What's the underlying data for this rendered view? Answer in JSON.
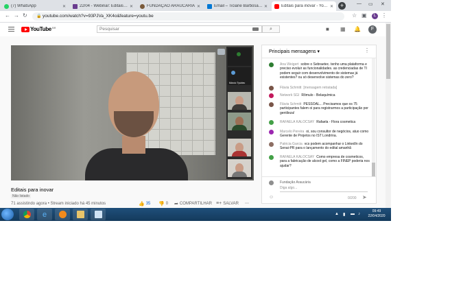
{
  "browser": {
    "tabs": [
      {
        "label": "(7) WhatsApp",
        "color": "#25d366"
      },
      {
        "label": "22/04 - Webinar: Editais para inovar",
        "color": "#6a3c8f"
      },
      {
        "label": "FUNDAÇÃO ARAUCÁRIA",
        "color": "#7a5a3a"
      },
      {
        "label": "Email – Ticiane Barbosa – Outlook",
        "color": "#0078d4"
      },
      {
        "label": "Editais para inovar - YouTube",
        "color": "#ff0000"
      }
    ],
    "url": "youtube.com/watch?v=93PJVa_XK4o&feature=youtu.be",
    "profile_initial": "L"
  },
  "youtube": {
    "logo_text": "YouTube",
    "logo_region": "BR",
    "search_placeholder": "Pesquisar",
    "avatar_initial": "F"
  },
  "video": {
    "participants": [
      {
        "label": "Márcio Tysbiec"
      },
      {
        "label": ""
      },
      {
        "label": ""
      },
      {
        "label": ""
      },
      {
        "label": ""
      }
    ],
    "title": "Editais para inovar",
    "visibility": "Não listado",
    "stats": "71 assistindo agora • Stream iniciado há 45 minutos",
    "likes": "35",
    "dislikes": "0",
    "share_label": "COMPARTILHAR",
    "save_label": "SALVAR"
  },
  "chat": {
    "header": "Principais mensagens",
    "messages": [
      {
        "author": "Ana Weigert",
        "text": "sobre o Sebraetec. tenho uma plataforma e preciso evoluir as funcionalidades. as credenciadas de TI podem seguir com desenvolvimento de sistemas já existentes? ou só desenvolve sistemas do zero?",
        "color": "#2e7d32"
      },
      {
        "author": "Flávia Schmitt",
        "text": "[mensagem retratada]",
        "color": "#795548",
        "sys": true
      },
      {
        "author": "Network SGI",
        "text": "Rômulo - Belaquímica",
        "color": "#c2185b"
      },
      {
        "author": "Flávia Schmitt",
        "text": "PESSOAL... Precisamos que os 75 participantes falem oi para registrarmos a participação por gentileza!",
        "color": "#795548"
      },
      {
        "author": "RAFAELA KALOCSAY",
        "text": "Rafaela - Flora cosmetica",
        "color": "#43a047"
      },
      {
        "author": "Marcelo Pereira",
        "text": "oi, sou consultor de negócios, atuo como Gerente de Projetos no IST Londrina.",
        "color": "#9c27b0"
      },
      {
        "author": "Patricia Garcia",
        "text": "vcs podem acompanhar o LinkedIn do Senai-PR para o lançamento do edital amanhã",
        "color": "#8d6e63"
      },
      {
        "author": "RAFAELA KALOCSAY",
        "text": "Como empresa de cosmeticos, para a fabricação de alcool gel, como a FINEP poderia nos ajudar?",
        "color": "#43a047"
      }
    ],
    "composer_name": "Fundação Araucária",
    "composer_placeholder": "Diga algo...",
    "char_count": "0/200"
  },
  "taskbar": {
    "time": "09:49",
    "date": "22/04/2020"
  }
}
